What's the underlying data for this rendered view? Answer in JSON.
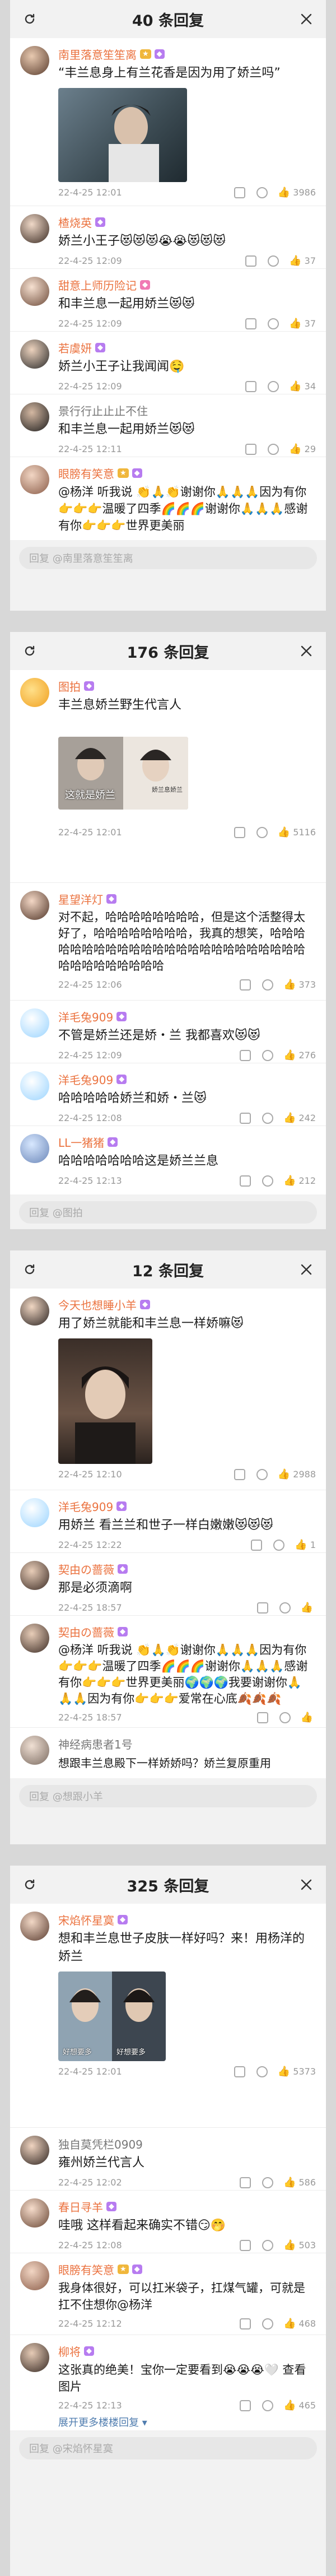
{
  "panels": [
    {
      "title": "40 条回复",
      "reply_placeholder": "回复 @南里落意笙笙离",
      "comments": [
        {
          "user": "南里落意笙笙离",
          "badge": "",
          "text": "“丰兰息身上有兰花香是因为用了娇兰吗”",
          "time": "22-4-25 12:01",
          "likes": "3986",
          "image": true
        },
        {
          "user": "楂烧英",
          "badge": "",
          "text": "娇兰小王子😻😻😻😭😭😻😻😻",
          "time": "22-4-25 12:09",
          "likes": "37"
        },
        {
          "user": "甜意上师历险记",
          "badge": "",
          "text": "和丰兰息一起用娇兰😻😻",
          "time": "22-4-25 12:09",
          "likes": "37"
        },
        {
          "user": "若虞妍",
          "badge": "",
          "text": "娇兰小王子让我闻闻🤤",
          "time": "22-4-25 12:09",
          "likes": "34"
        },
        {
          "user": "景行行止止止不住",
          "badge": "",
          "text": "和丰兰息一起用娇兰😻😻",
          "time": "22-4-25 12:11",
          "likes": "29"
        },
        {
          "user": "眼膀有笑意",
          "badge": "",
          "text": "@杨洋 听我说 👏🙏👏谢谢你🙏🙏🙏因为有你👉👉👉温暖了四季🌈🌈🌈谢谢你🙏🙏🙏感谢有你👉👉👉世界更美丽",
          "time": "",
          "likes": ""
        }
      ]
    },
    {
      "title": "176 条回复",
      "reply_placeholder": "回复 @图拍",
      "comments": [
        {
          "user": "图拍",
          "badge": "",
          "text": "丰兰息娇兰野生代言人",
          "time": "22-4-25 12:01",
          "likes": "5116",
          "image": true,
          "image_caption": "这就是娇兰",
          "image_caption2": "娇兰息娇兰"
        },
        {
          "user": "星望洋灯",
          "badge": "",
          "text": "对不起，哈哈哈哈哈哈哈哈，但是这个活整得太好了，哈哈哈哈哈哈哈哈，我真的想笑，哈哈哈哈哈哈哈哈哈哈哈哈哈哈哈哈哈哈哈哈哈哈哈哈哈哈哈哈哈哈哈哈哈",
          "time": "22-4-25 12:06",
          "likes": "373"
        },
        {
          "user": "洋毛兔909",
          "badge": "",
          "text": "不管是娇兰还是娇・兰 我都喜欢😻😻",
          "time": "22-4-25 12:09",
          "likes": "276"
        },
        {
          "user": "洋毛兔909",
          "badge": "",
          "text": "哈哈哈哈哈娇兰和娇・兰😻",
          "time": "22-4-25 12:08",
          "likes": "242"
        },
        {
          "user": "LL一猪猪",
          "badge": "",
          "text": "哈哈哈哈哈哈哈这是娇兰兰息",
          "time": "22-4-25 12:13",
          "likes": "212"
        }
      ]
    },
    {
      "title": "12 条回复",
      "reply_placeholder": "回复 @想跟小羊",
      "comments": [
        {
          "user": "今天也想睡小羊",
          "badge": "",
          "text": "用了娇兰就能和丰兰息一样娇嘛😻",
          "time": "22-4-25 12:10",
          "likes": "2988",
          "image": true
        },
        {
          "user": "洋毛兔909",
          "badge": "",
          "text": "用娇兰 看兰兰和世子一样白嫩嫩😻😻😻",
          "time": "22-4-25 12:22",
          "likes": "1"
        },
        {
          "user": "契由の蔷薇",
          "badge": "",
          "text": "那是必须滴啊",
          "time": "22-4-25 18:57",
          "likes": ""
        },
        {
          "user": "契由の蔷薇",
          "badge": "",
          "text": "@杨洋 听我说 👏🙏👏谢谢你🙏🙏🙏因为有你👉👉👉温暖了四季🌈🌈🌈谢谢你🙏🙏🙏感谢有你👉👉👉世界更美丽🌍🌍🌍我要谢谢你🙏🙏🙏因为有你👉👉👉爱常在心底🍂🍂🍂",
          "time": "22-4-25 18:57",
          "likes": ""
        },
        {
          "user": "神经病患者1号",
          "badge": "",
          "text": "想跟丰兰息殿下一样娇娇吗？娇兰复原重用",
          "time": "",
          "likes": ""
        }
      ]
    },
    {
      "title": "325 条回复",
      "reply_placeholder": "回复 @宋焰怀星寞",
      "comments": [
        {
          "user": "宋焰怀星寞",
          "badge": "",
          "text": "想和丰兰息世子皮肤一样好吗？来！用杨洋的娇兰",
          "time": "22-4-25 12:01",
          "likes": "5373",
          "image": true,
          "image_caption": "好想要多",
          "image_caption2": "好想要多"
        },
        {
          "user": "独自莫凭栏0909",
          "badge": "",
          "text": "雍州娇兰代言人",
          "time": "22-4-25 12:02",
          "likes": "586"
        },
        {
          "user": "春日寻羊",
          "badge": "",
          "text": "哇哦 这样看起来确实不错😏🤭",
          "time": "22-4-25 12:08",
          "likes": "503"
        },
        {
          "user": "眼膀有笑意",
          "badge": "",
          "text": "我身体很好，可以扛米袋子，扛煤气罐，可就是扛不住想你@杨洋",
          "time": "22-4-25 12:12",
          "likes": "468"
        },
        {
          "user": "柳将",
          "badge": "",
          "text": "这张真的绝美！宝你一定要看到😭😭😭🤍 查看图片",
          "time": "22-4-25 12:13",
          "likes": "465"
        }
      ],
      "expand_label": "展开更多楼楼回复 ▾"
    }
  ],
  "colors": {
    "username": "#eb7340",
    "link": "#507daf",
    "badge_purple": "#b77cf0",
    "header_bg": "#f2f2f2"
  }
}
